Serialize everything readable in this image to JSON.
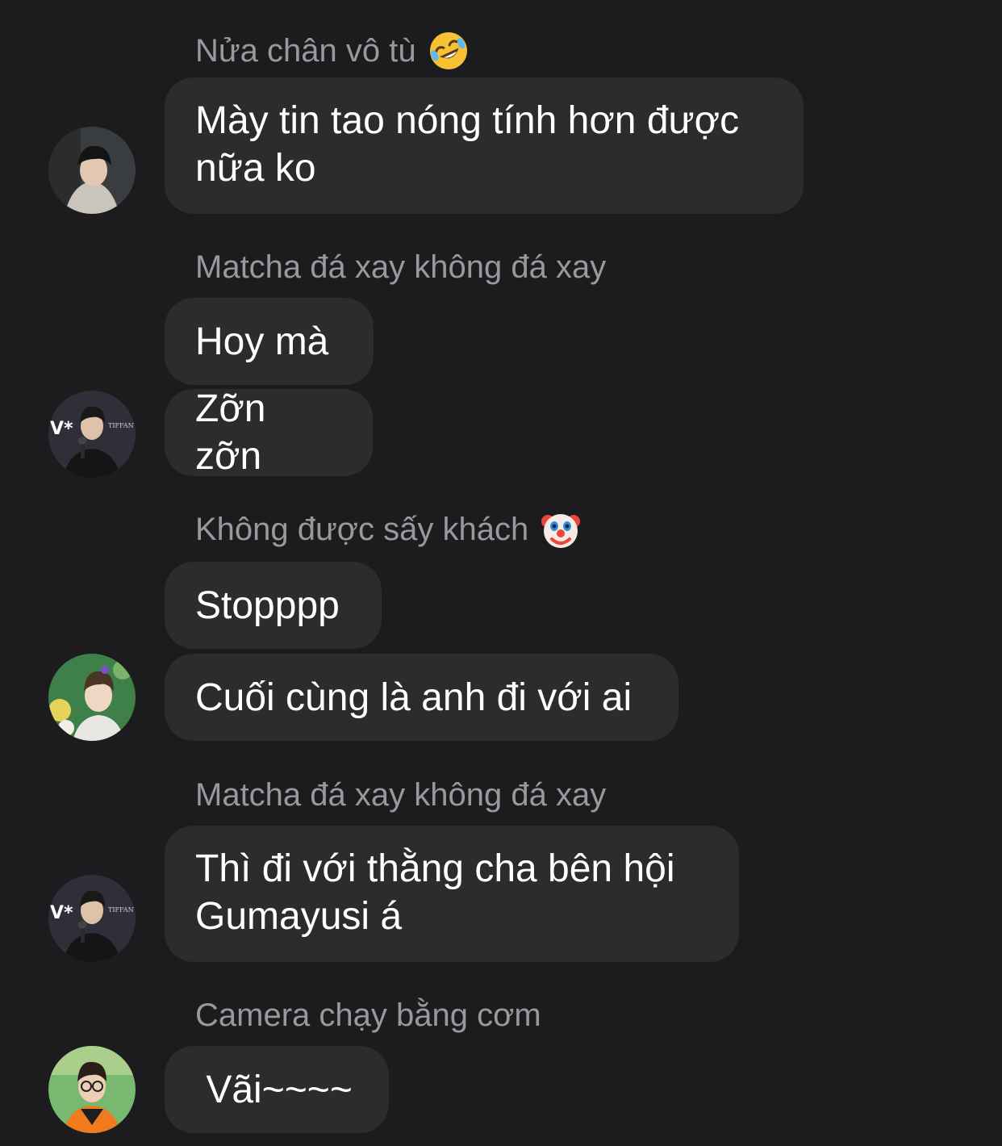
{
  "conversation": [
    {
      "sender": "Nửa chân vô tù",
      "sender_emoji": "rolling-on-floor-laughing-icon",
      "avatar": "avatar-hoodie-boy",
      "messages": [
        "Mày tin tao nóng tính hơn được nữa ko"
      ]
    },
    {
      "sender": "Matcha đá xay không đá xay",
      "avatar": "avatar-man-microphone",
      "messages": [
        "Hoy mà",
        "Zỡn zỡn"
      ]
    },
    {
      "sender": "Không được sấy khách",
      "sender_emoji": "clown-face-icon",
      "avatar": "avatar-boy-flowers",
      "messages": [
        "Stopppp",
        "Cuối cùng là anh đi với ai"
      ]
    },
    {
      "sender": "Matcha đá xay không đá xay",
      "avatar": "avatar-man-microphone",
      "messages": [
        "Thì đi với thằng cha bên hội Gumayusi á"
      ]
    },
    {
      "sender": "Camera chạy bằng cơm",
      "avatar": "avatar-glasses-orange-jersey",
      "messages": [
        " Vãi~~~~"
      ]
    }
  ],
  "avatar_backdrop": {
    "microphone_sign": "V*",
    "microphone_brand": "TIFFANY"
  },
  "colors": {
    "background": "#1c1c1e",
    "bubble": "#2c2c2e",
    "sender_text": "#98989d",
    "message_text": "#ffffff"
  }
}
